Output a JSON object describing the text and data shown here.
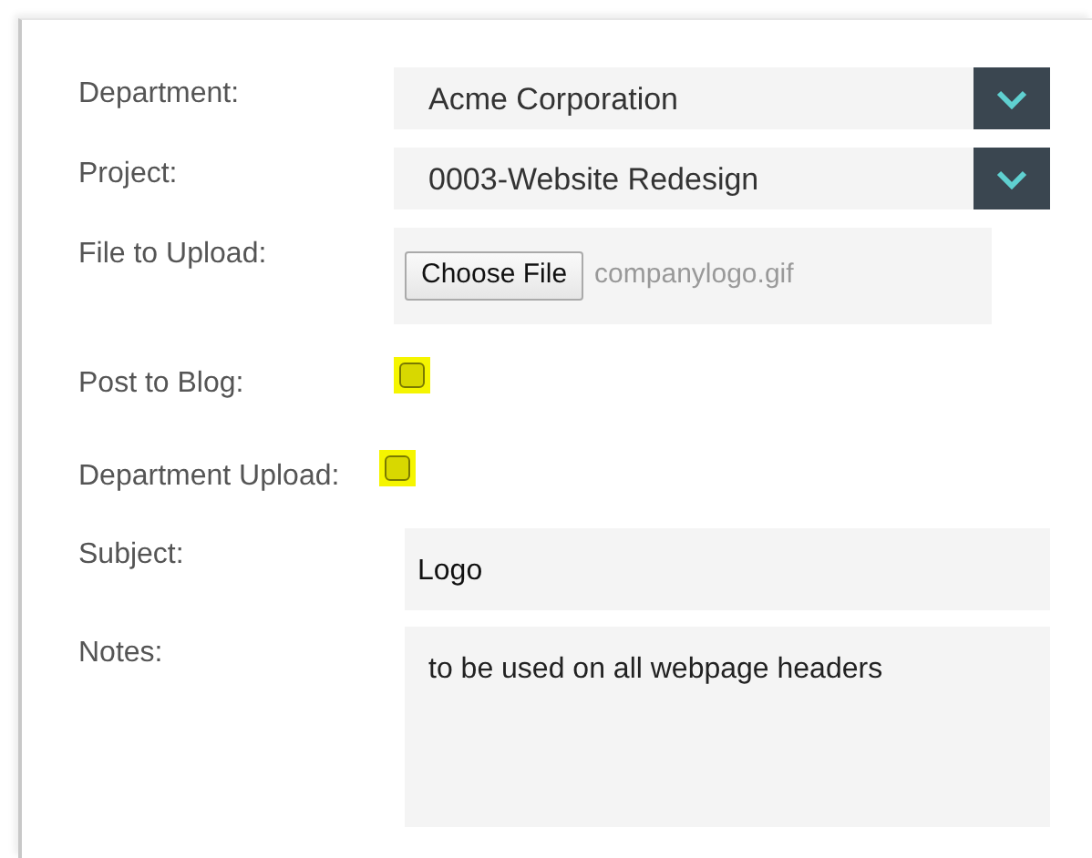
{
  "form": {
    "fields": [
      {
        "kind": "select",
        "label": "Department:",
        "value": "Acme Corporation"
      },
      {
        "kind": "select",
        "label": "Project:",
        "value": "0003-Website Redesign"
      },
      {
        "kind": "file",
        "label": "File to Upload:",
        "button": "Choose File",
        "value": "companylogo.gif"
      },
      {
        "kind": "checkbox",
        "label": "Post to Blog:",
        "checked": false,
        "highlighted": true
      },
      {
        "kind": "checkbox",
        "label": "Department Upload:",
        "checked": false,
        "highlighted": true
      },
      {
        "kind": "text",
        "label": "Subject:",
        "value": "Logo"
      },
      {
        "kind": "textarea",
        "label": "Notes:",
        "value": "to be used on all webpage headers"
      }
    ]
  }
}
